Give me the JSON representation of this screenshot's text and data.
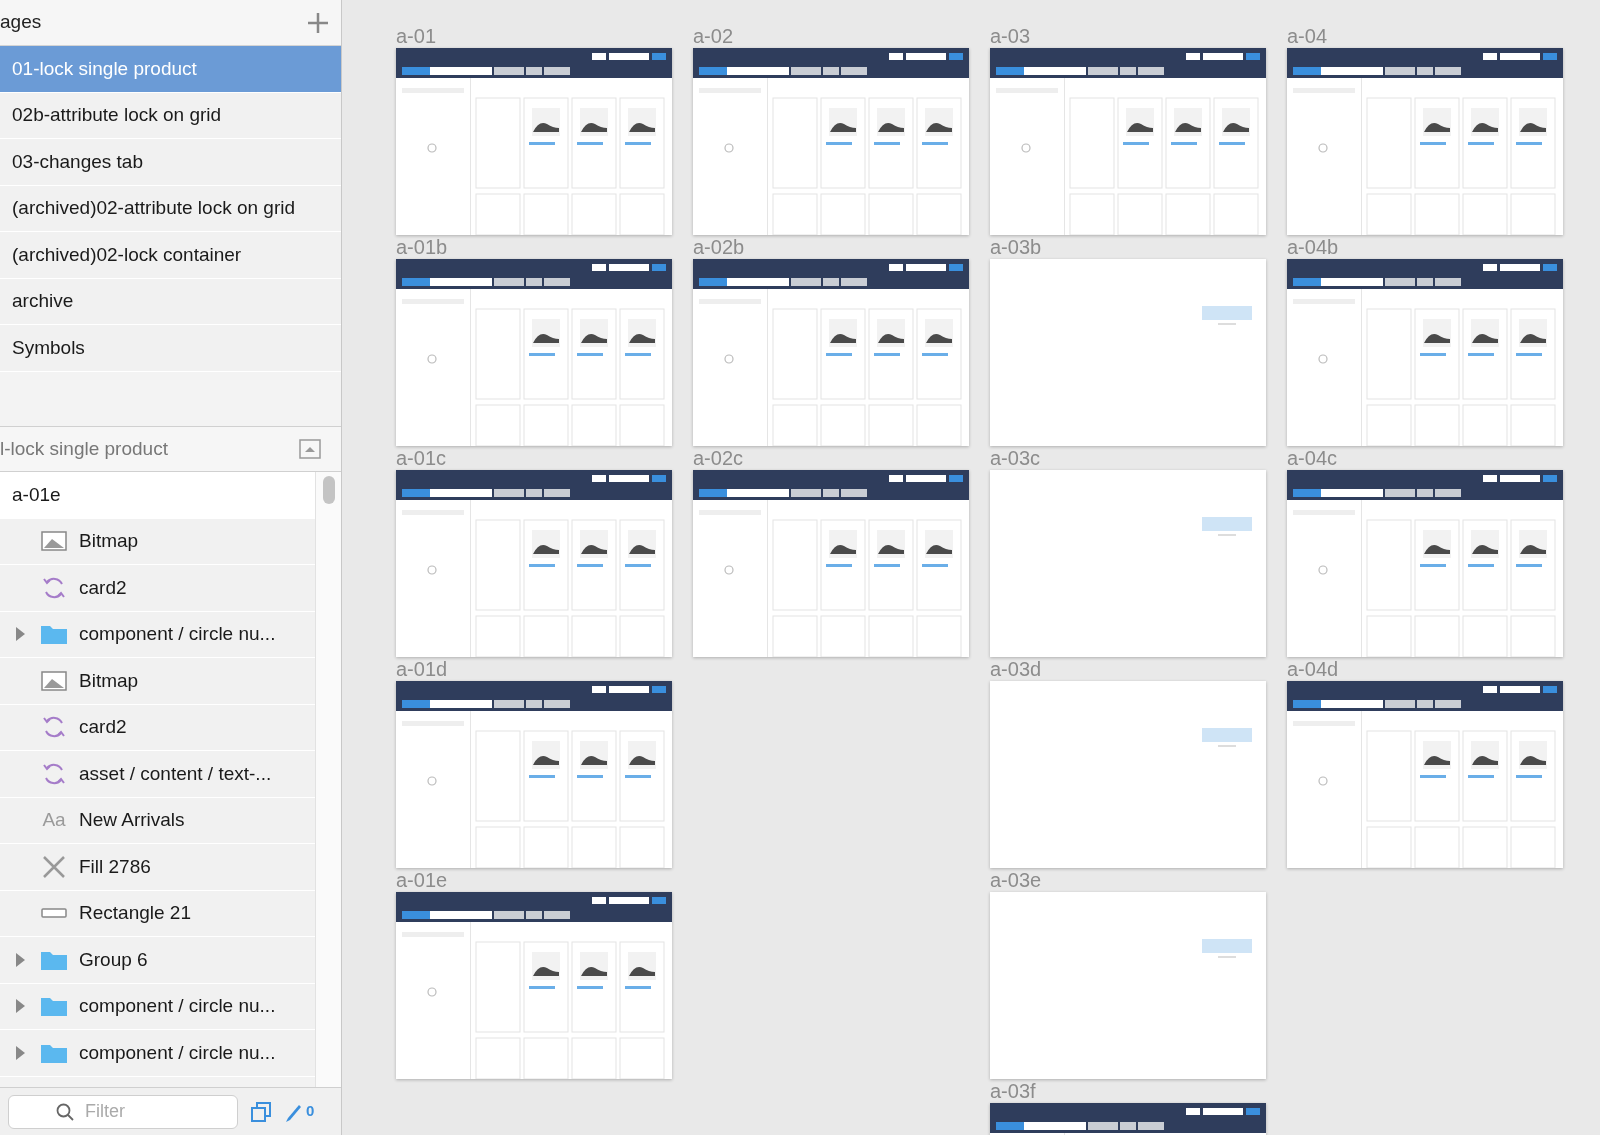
{
  "pages": {
    "title": "ages",
    "items": [
      {
        "label": "01-lock single product",
        "selected": true
      },
      {
        "label": "02b-attribute lock on grid",
        "selected": false
      },
      {
        "label": "03-changes tab",
        "selected": false
      },
      {
        "label": "(archived)02-attribute lock on grid",
        "selected": false
      },
      {
        "label": "(archived)02-lock container",
        "selected": false
      },
      {
        "label": "archive",
        "selected": false
      },
      {
        "label": "Symbols",
        "selected": false
      }
    ]
  },
  "layers": {
    "title": "l-lock single product",
    "items": [
      {
        "label": "a-01e",
        "kind": "artboard"
      },
      {
        "label": "Bitmap",
        "kind": "bitmap"
      },
      {
        "label": "card2",
        "kind": "symbol"
      },
      {
        "label": "component / circle nu...",
        "kind": "group",
        "expanded": false
      },
      {
        "label": "Bitmap",
        "kind": "bitmap"
      },
      {
        "label": "card2",
        "kind": "symbol"
      },
      {
        "label": "asset / content / text-...",
        "kind": "symbol"
      },
      {
        "label": "New Arrivals",
        "kind": "text",
        "icon_text": "Aa"
      },
      {
        "label": "Fill 2786",
        "kind": "shape"
      },
      {
        "label": "Rectangle 21",
        "kind": "rectangle"
      },
      {
        "label": "Group 6",
        "kind": "group",
        "expanded": false
      },
      {
        "label": "component / circle nu...",
        "kind": "group",
        "expanded": false
      },
      {
        "label": "component / circle nu...",
        "kind": "group",
        "expanded": false
      }
    ]
  },
  "filter": {
    "placeholder": "Filter"
  },
  "edit_count": "0",
  "artboard_columns": [
    [
      {
        "label": "a-01",
        "kind": "grid"
      },
      {
        "label": "a-01b",
        "kind": "grid"
      },
      {
        "label": "a-01c",
        "kind": "grid"
      },
      {
        "label": "a-01d",
        "kind": "grid"
      },
      {
        "label": "a-01e",
        "kind": "grid"
      }
    ],
    [
      {
        "label": "a-02",
        "kind": "grid"
      },
      {
        "label": "a-02b",
        "kind": "grid"
      },
      {
        "label": "a-02c",
        "kind": "grid"
      }
    ],
    [
      {
        "label": "a-03",
        "kind": "grid"
      },
      {
        "label": "a-03b",
        "kind": "blank"
      },
      {
        "label": "a-03c",
        "kind": "blank"
      },
      {
        "label": "a-03d",
        "kind": "blank"
      },
      {
        "label": "a-03e",
        "kind": "blank"
      },
      {
        "label": "a-03f",
        "kind": "grid"
      }
    ],
    [
      {
        "label": "a-04",
        "kind": "grid"
      },
      {
        "label": "a-04b",
        "kind": "grid"
      },
      {
        "label": "a-04c",
        "kind": "grid"
      },
      {
        "label": "a-04d",
        "kind": "grid"
      }
    ]
  ]
}
